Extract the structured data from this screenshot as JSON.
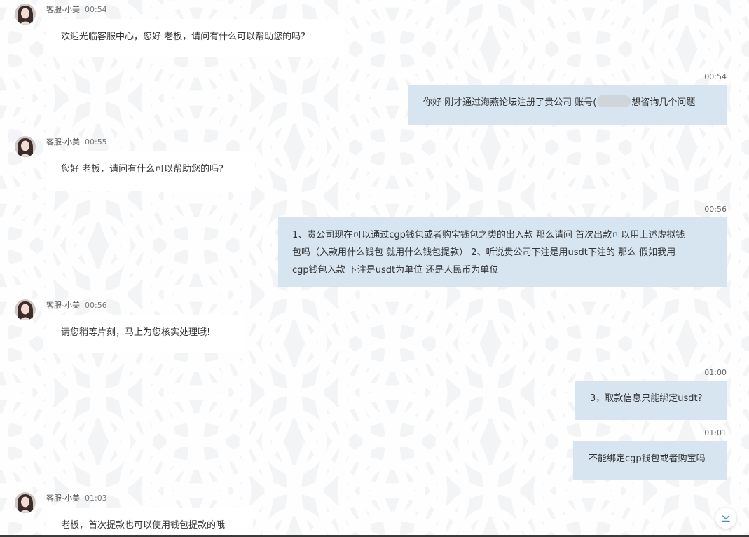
{
  "colors": {
    "background": "#f3f4f6",
    "incoming_bubble": "#ffffff",
    "outgoing_bubble": "#d7e5f0",
    "redaction": "#d0d5da"
  },
  "icons": {
    "avatar": "avatar-icon",
    "scroll_to_bottom": "chevron-down-icon"
  },
  "messages": [
    {
      "direction": "in",
      "sender": "客服-小美",
      "time": "00:54",
      "text": "欢迎光临客服中心，您好 老板，请问有什么可以帮助您的吗?"
    },
    {
      "direction": "out",
      "time": "00:54",
      "text_before_redaction": "你好 刚才通过海燕论坛注册了贵公司 账号(",
      "text_after_redaction": "想咨询几个问题"
    },
    {
      "direction": "in",
      "sender": "客服-小美",
      "time": "00:55",
      "text": "您好 老板，请问有什么可以帮助您的吗?"
    },
    {
      "direction": "out",
      "time": "00:56",
      "lines": [
        "1、贵公司现在可以通过cgp钱包或者购宝钱包之类的出入款 那么请问 首次出款可以用上述虚拟钱",
        "包吗（入款用什么钱包 就用什么钱包提款） 2、听说贵公司下注是用usdt下注的 那么 假如我用",
        "cgp钱包入款 下注是usdt为单位 还是人民币为单位"
      ]
    },
    {
      "direction": "in",
      "sender": "客服-小美",
      "time": "00:56",
      "text": "请您稍等片刻，马上为您核实处理哦!"
    },
    {
      "direction": "out",
      "time": "01:00",
      "text": "3，取款信息只能绑定usdt?"
    },
    {
      "direction": "out",
      "time": "01:01",
      "text": "不能绑定cgp钱包或者购宝吗"
    },
    {
      "direction": "in",
      "sender": "客服-小美",
      "time": "01:03",
      "text": "老板，首次提款也可以使用钱包提款的哦"
    }
  ]
}
